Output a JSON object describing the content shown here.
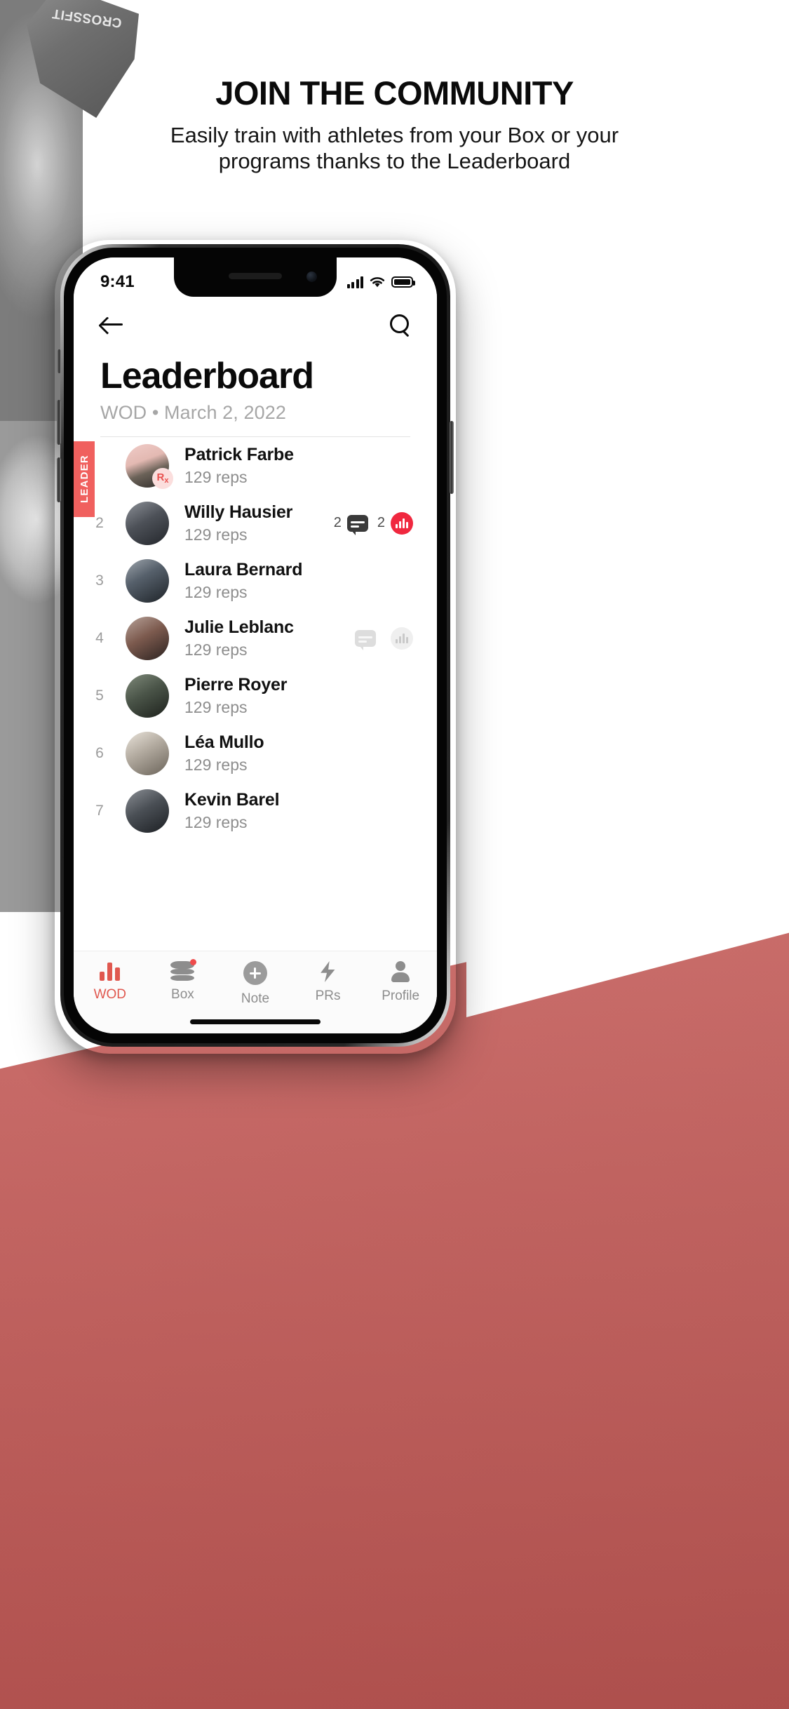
{
  "promo": {
    "headline": "JOIN THE COMMUNITY",
    "subheadline": "Easily train with athletes from your Box or your programs thanks to the Leaderboard",
    "kettlebell_logo": "CROSSFIT"
  },
  "colors": {
    "accent_red": "#f0605e",
    "tab_active": "#e0584f",
    "clap_red": "#f0283f",
    "rx_badge_bg": "#fbdedd",
    "rx_badge_text": "#e8504e",
    "muted_text": "#8e8e8e",
    "background_red": "#c05a57"
  },
  "status_bar": {
    "time": "9:41",
    "signal_icon": "cellular-signal-icon",
    "wifi_icon": "wifi-icon",
    "battery_icon": "battery-icon"
  },
  "appbar": {
    "back_icon": "arrow-left-icon",
    "search_icon": "search-icon"
  },
  "header": {
    "title": "Leaderboard",
    "subtitle": "WOD • March 2, 2022"
  },
  "leader_badge": "LEADER",
  "rows": [
    {
      "rank": "",
      "name": "Patrick Farbe",
      "reps": "129 reps",
      "is_leader": true,
      "rx": "Rx",
      "comment_count": "",
      "clap_count": "",
      "actions_state": "none"
    },
    {
      "rank": "2",
      "name": "Willy Hausier",
      "reps": "129 reps",
      "is_leader": false,
      "rx": "",
      "comment_count": "2",
      "clap_count": "2",
      "actions_state": "active"
    },
    {
      "rank": "3",
      "name": "Laura Bernard",
      "reps": "129 reps",
      "is_leader": false,
      "rx": "",
      "comment_count": "",
      "clap_count": "",
      "actions_state": "none"
    },
    {
      "rank": "4",
      "name": "Julie Leblanc",
      "reps": "129 reps",
      "is_leader": false,
      "rx": "",
      "comment_count": "",
      "clap_count": "",
      "actions_state": "dim"
    },
    {
      "rank": "5",
      "name": "Pierre Royer",
      "reps": "129 reps",
      "is_leader": false,
      "rx": "",
      "comment_count": "",
      "clap_count": "",
      "actions_state": "none"
    },
    {
      "rank": "6",
      "name": "Léa Mullo",
      "reps": "129 reps",
      "is_leader": false,
      "rx": "",
      "comment_count": "",
      "clap_count": "",
      "actions_state": "none"
    },
    {
      "rank": "7",
      "name": "Kevin Barel",
      "reps": "129 reps",
      "is_leader": false,
      "rx": "",
      "comment_count": "",
      "clap_count": "",
      "actions_state": "none"
    }
  ],
  "tabbar": {
    "items": [
      {
        "label": "WOD",
        "icon": "bar-chart-icon",
        "active": true,
        "badge": false
      },
      {
        "label": "Box",
        "icon": "layers-icon",
        "active": false,
        "badge": true
      },
      {
        "label": "Note",
        "icon": "plus-circle-icon",
        "active": false,
        "badge": false
      },
      {
        "label": "PRs",
        "icon": "lightning-bolt-icon",
        "active": false,
        "badge": false
      },
      {
        "label": "Profile",
        "icon": "person-icon",
        "active": false,
        "badge": false
      }
    ]
  }
}
